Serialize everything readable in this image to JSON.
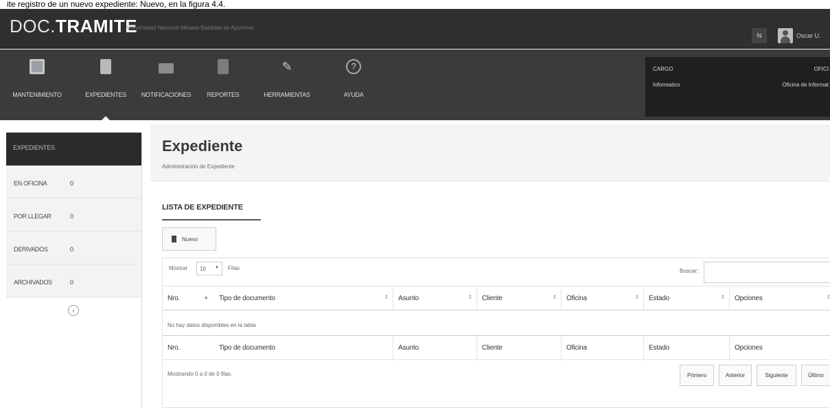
{
  "caption": "ite registro de un nuevo expediente: Nuevo, en la figura 4.4.",
  "header": {
    "brand_prefix": "DOC.",
    "brand_main": "TRAMITE",
    "brand_subtitle": "Universidad Nacional Micaela Bastidas de Apurimac",
    "notif_badge": "N",
    "user_name": "Oscar U."
  },
  "nav": [
    {
      "label": "MANTENIMIENTO",
      "icon": "monitor-icon"
    },
    {
      "label": "EXPEDIENTES",
      "icon": "files-icon",
      "active": true
    },
    {
      "label": "NOTIFICACIONES",
      "icon": "mail-icon"
    },
    {
      "label": "REPORTES",
      "icon": "report-icon"
    },
    {
      "label": "HERRAMIENTAS",
      "icon": "tools-icon"
    },
    {
      "label": "AYUDA",
      "icon": "help-icon"
    }
  ],
  "info": {
    "cargo_label": "CARGO",
    "oficina_label": "OFICI",
    "cargo_value": "Informatico",
    "oficina_value": "Oficina de Informat"
  },
  "sidebar": {
    "title": "EXPEDIENTES",
    "items": [
      {
        "label": "EN OFICINA",
        "count": "0"
      },
      {
        "label": "POR LLEGAR",
        "count": "0"
      },
      {
        "label": "DERIVADOS",
        "count": "0"
      },
      {
        "label": "ARCHIVADOS",
        "count": "0"
      }
    ],
    "collapse_glyph": "‹"
  },
  "page": {
    "title": "Expediente",
    "subtitle": "Administración de Expediente",
    "list_title": "LISTA DE EXPEDIENTE",
    "new_button": "Nuevo"
  },
  "table": {
    "show_label": "Mostrar",
    "length_value": "10",
    "rows_label": "Filas",
    "search_label": "Buscar:",
    "columns": [
      "Nro.",
      "Tipo de documento",
      "Asunto",
      "Cliente",
      "Oficina",
      "Estado",
      "Opciones"
    ],
    "empty_message": "No hay datos disponibles en la tabla",
    "info": "Mostrando 0 a 0 de 0 filas.",
    "pager": [
      "Primero",
      "Anterior",
      "Siguiente",
      "Último"
    ]
  }
}
